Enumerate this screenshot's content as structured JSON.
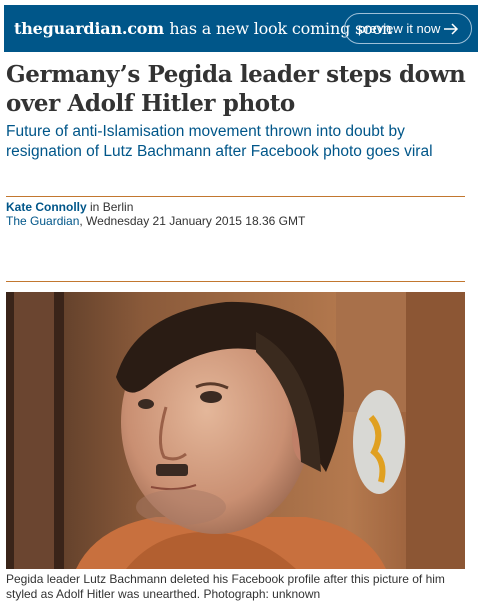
{
  "banner": {
    "site": "theguardian.com",
    "message": "has a new look coming soon",
    "button_label": "preview it now",
    "button_icon": "arrow-right-icon",
    "background": "#005689"
  },
  "article": {
    "headline": "Germany’s Pegida leader steps down over Adolf Hitler photo",
    "standfirst": "Future of anti-Islamisation movement thrown into doubt by resignation of Lutz Bachmann after Facebook photo goes viral",
    "byline": {
      "author": "Kate Connolly",
      "location": "in Berlin",
      "publication": "The Guardian",
      "date": ", Wednesday 21 January 2015 18.36 GMT"
    },
    "image_caption": "Pegida leader Lutz Bachmann deleted his Facebook profile after this picture of him styled as Adolf Hitler was unearthed. Photograph: unknown"
  },
  "colors": {
    "accent": "#005689",
    "rule": "#c2772f",
    "text": "#333333"
  }
}
